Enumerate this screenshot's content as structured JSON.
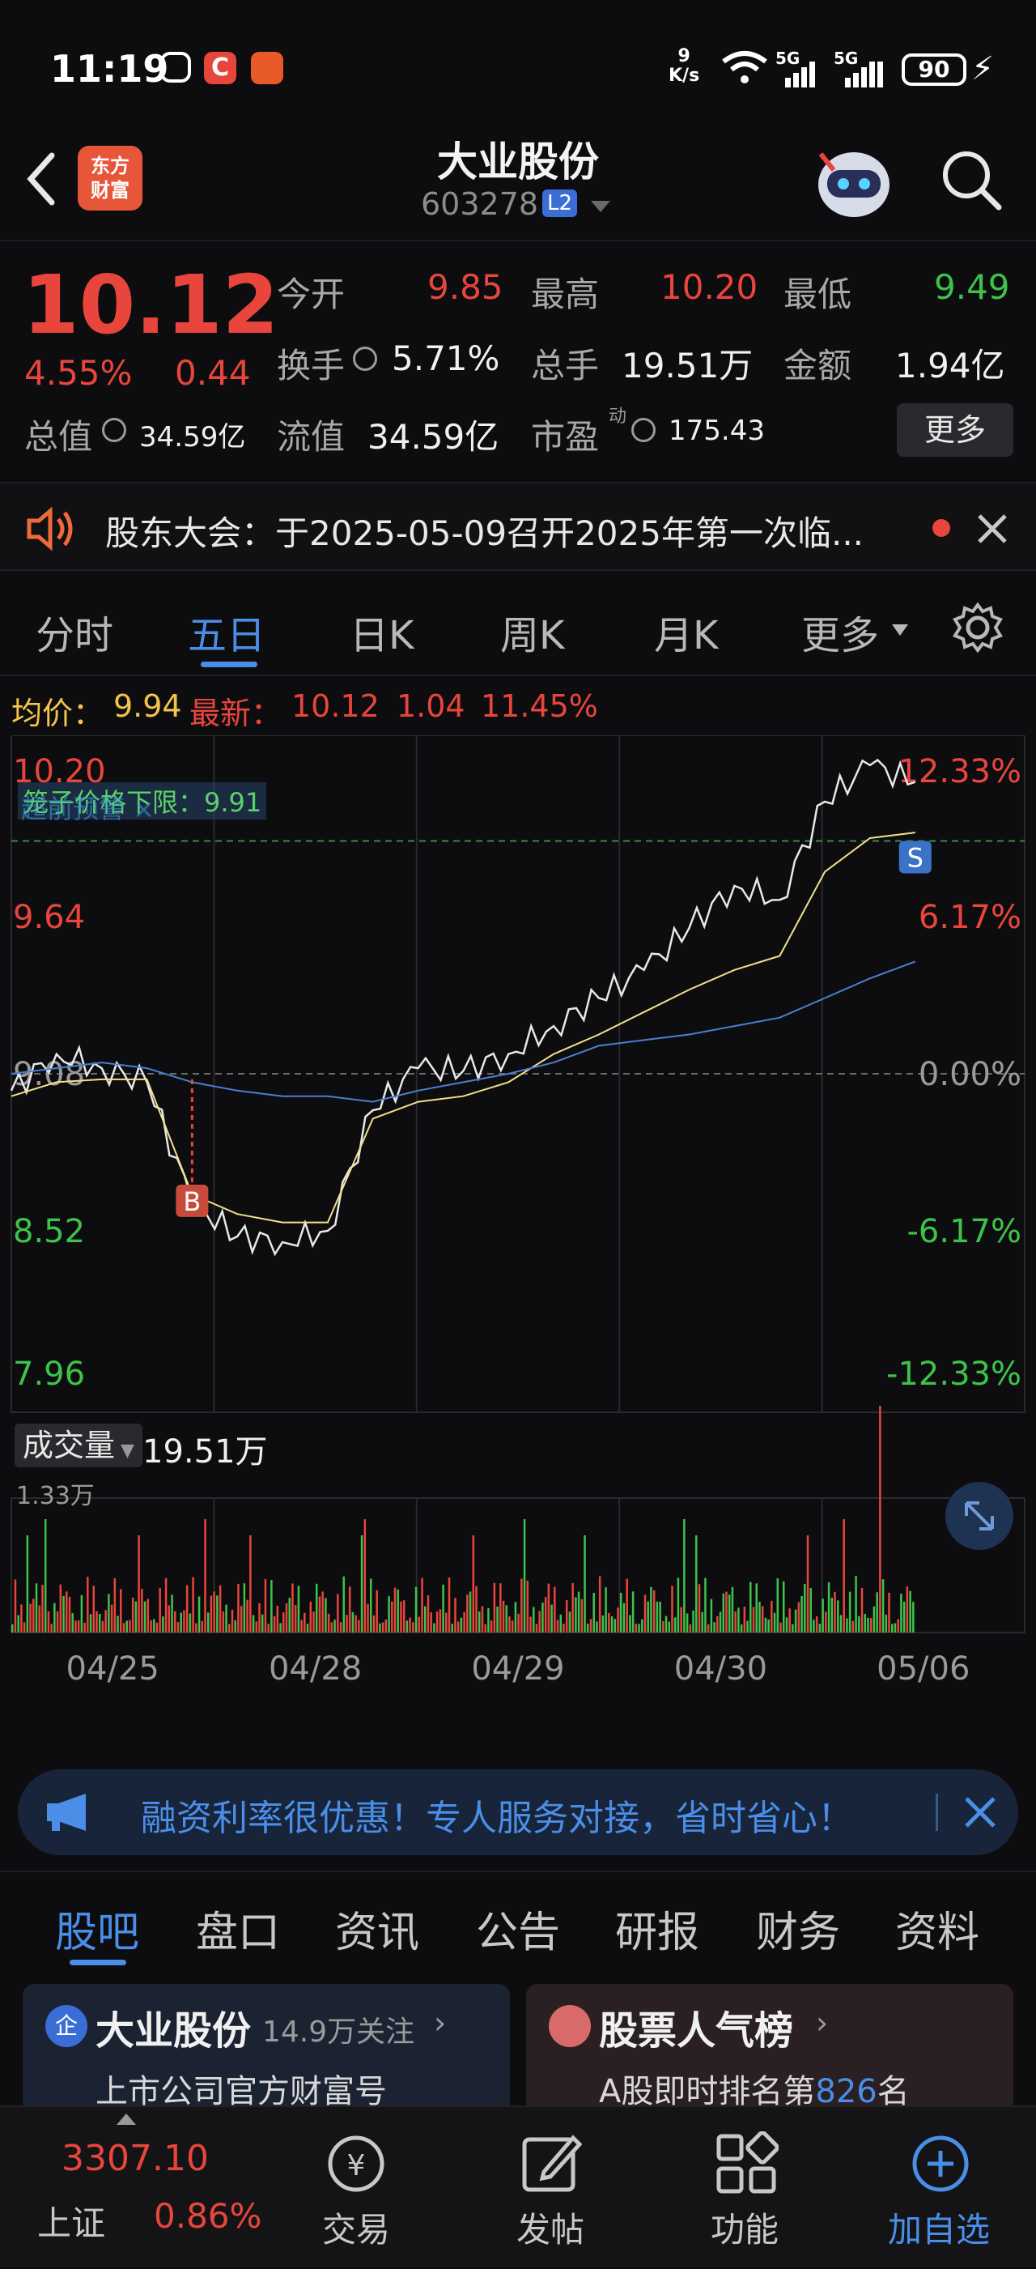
{
  "status_bar": {
    "time": "11:19",
    "net_speed_value": "9",
    "net_speed_unit": "K/s",
    "signal1": "5G",
    "signal2": "5G",
    "battery": "90"
  },
  "header": {
    "logo_line1": "东方",
    "logo_line2": "财富",
    "title": "大业股份",
    "code": "603278",
    "level": "L2"
  },
  "quote": {
    "price": "10.12",
    "change_pct": "4.55%",
    "change": "0.44",
    "open_label": "今开",
    "open": "9.85",
    "high_label": "最高",
    "high": "10.20",
    "low_label": "最低",
    "low": "9.49",
    "turnover_label": "换手",
    "turnover": "5.71%",
    "volume_label": "总手",
    "volume": "19.51万",
    "amount_label": "金额",
    "amount": "1.94亿",
    "mcap_label": "总值",
    "mcap": "34.59亿",
    "float_label": "流值",
    "float_value": "34.59亿",
    "pe_label": "市盈",
    "pe_sup": "动",
    "pe": "175.43",
    "more_button": "更多"
  },
  "notice": {
    "text": "股东大会：于2025-05-09召开2025年第一次临..."
  },
  "chart_tabs": [
    "分时",
    "五日",
    "日K",
    "周K",
    "月K",
    "更多"
  ],
  "chart_tabs_active": 1,
  "chart_info": {
    "avg_label": "均价：",
    "avg_value": "9.94",
    "latest_label": "最新：",
    "latest_value": "10.12",
    "latest_change": "1.04",
    "latest_pct": "11.45%",
    "limit_note": "笼子价格下限：9.91",
    "overlay_note": "超前预警  ×"
  },
  "chart_data": {
    "type": "line",
    "title": "",
    "days": [
      "04/25",
      "04/28",
      "04/29",
      "04/30",
      "05/06"
    ],
    "y_left_ticks": [
      "10.20",
      "9.64",
      "9.08",
      "8.52",
      "7.96"
    ],
    "y_right_ticks": [
      "12.33%",
      "6.17%",
      "0.00%",
      "-6.17%",
      "-12.33%"
    ],
    "ylim": [
      7.96,
      10.2
    ],
    "reference_price": 9.08,
    "series": [
      {
        "name": "",
        "color": "#e8e8e8",
        "values": [
          9.02,
          9.15,
          9.1,
          9.05,
          8.62,
          8.5,
          8.48,
          8.52,
          8.95,
          9.1,
          9.09,
          9.15,
          9.25,
          9.35,
          9.45,
          9.6,
          9.75,
          9.7,
          10.05,
          10.18,
          10.12
        ]
      },
      {
        "name": "",
        "color": "#f3e08a",
        "values": [
          9.0,
          9.05,
          9.06,
          9.06,
          8.65,
          8.58,
          8.55,
          8.55,
          8.92,
          8.98,
          9.0,
          9.05,
          9.15,
          9.22,
          9.3,
          9.38,
          9.45,
          9.5,
          9.8,
          9.92,
          9.94
        ]
      },
      {
        "name": "",
        "color": "#4a7fd0",
        "values": [
          9.08,
          9.1,
          9.12,
          9.1,
          9.05,
          9.02,
          9.0,
          9.0,
          8.98,
          9.02,
          9.05,
          9.08,
          9.12,
          9.18,
          9.2,
          9.22,
          9.25,
          9.28,
          9.35,
          9.42,
          9.48
        ]
      }
    ],
    "markers": [
      {
        "label": "B",
        "x_index": 4,
        "value": 9.06
      },
      {
        "label": "S",
        "x_index": 20,
        "value": 9.91
      }
    ],
    "volume": {
      "label": "成交量",
      "total": "19.51万",
      "max_label": "1.33万"
    }
  },
  "banner": {
    "text": "融资利率很优惠！专人服务对接，省时省心！"
  },
  "section_tabs": [
    "股吧",
    "盘口",
    "资讯",
    "公告",
    "研报",
    "财务",
    "资料"
  ],
  "section_tabs_active": 0,
  "cards": {
    "left_title": "大业股份",
    "left_follow": "14.9万关注",
    "left_sub": "上市公司官方财富号",
    "left_badge": "企",
    "right_title": "股票人气榜",
    "right_sub_prefix": "A股即时排名第",
    "right_rank": "826",
    "right_sub_suffix": "名"
  },
  "bottom_nav": {
    "index_value": "3307.10",
    "index_name": "上证",
    "index_pct": "0.86%",
    "trade": "交易",
    "post": "发帖",
    "functions": "功能",
    "add_watch": "加自选"
  },
  "colors": {
    "up": "#e8453c",
    "down": "#3ec34a",
    "accent": "#4a8ee8"
  }
}
